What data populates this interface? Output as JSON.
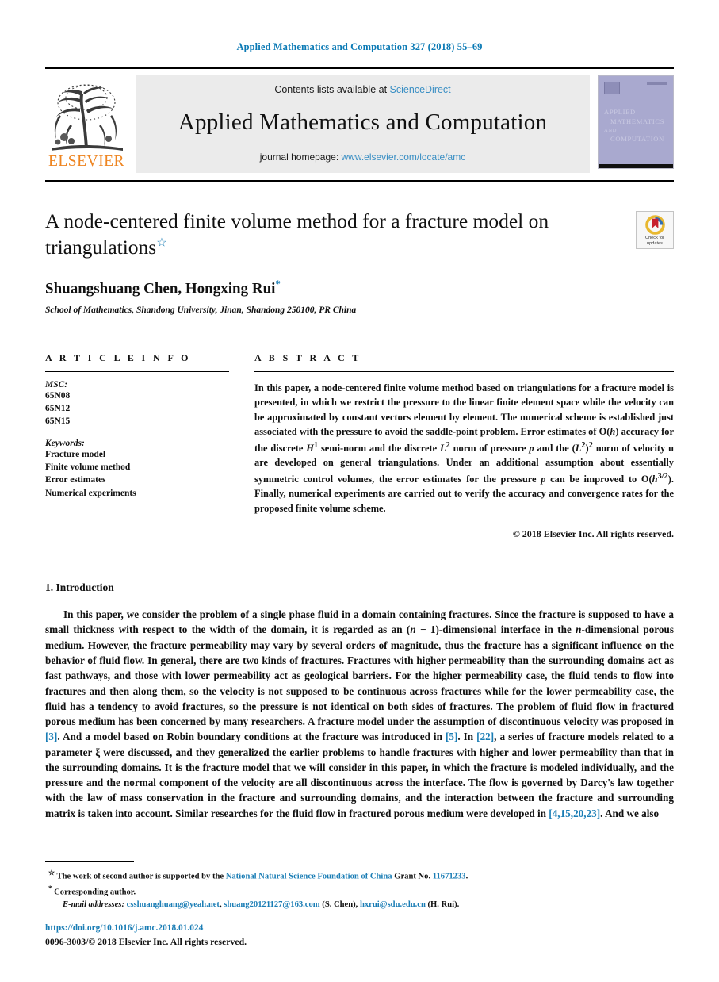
{
  "running_head": "Applied Mathematics and Computation 327 (2018) 55–69",
  "masthead": {
    "publisher_name": "ELSEVIER",
    "contents_prefix": "Contents lists available at",
    "contents_link": "ScienceDirect",
    "journal_name": "Applied Mathematics and Computation",
    "homepage_prefix": "journal homepage:",
    "homepage_url": "www.elsevier.com/locate/amc",
    "cover": {
      "line1": "APPLIED",
      "line2": "MATHEMATICS",
      "line3": "AND",
      "line4": "COMPUTATION"
    }
  },
  "article": {
    "title": "A node-centered finite volume method for a fracture model on triangulations",
    "title_footnote_symbol": "☆",
    "authors": "Shuangshuang Chen, Hongxing Rui",
    "corresponding_symbol": "*",
    "affiliation": "School of Mathematics, Shandong University, Jinan, Shandong 250100, PR China",
    "crossmark": {
      "line1": "Check for",
      "line2": "updates"
    }
  },
  "info": {
    "heading": "A R T I C L E   I N F O",
    "msc_label": "MSC:",
    "msc_codes": [
      "65N08",
      "65N12",
      "65N15"
    ],
    "keywords_label": "Keywords:",
    "keywords": [
      "Fracture model",
      "Finite volume method",
      "Error estimates",
      "Numerical experiments"
    ]
  },
  "abstract": {
    "heading": "A B S T R A C T",
    "part1": "In this paper, a node-centered finite volume method based on triangulations for a fracture model is presented, in which we restrict the pressure to the linear finite element space while the velocity can be approximated by constant vectors element by element. The numerical scheme is established just associated with the pressure to avoid the saddle-point problem. Error estimates of O(",
    "h1": "h",
    "part2": ") accuracy for the discrete ",
    "H1": "H",
    "sup1": "1",
    "part3": " semi-norm and the discrete ",
    "L1": "L",
    "sup2": "2",
    "part4": " norm of pressure ",
    "p1": "p",
    "part5": " and the (",
    "L2": "L",
    "sup3": "2",
    "part6": ")",
    "sup4": "2",
    "part7": " norm of velocity ",
    "u1": "u",
    "part8": " are developed on general triangulations. Under an additional assumption about essentially symmetric control volumes, the error estimates for the pressure ",
    "p2": "p",
    "part9": " can be improved to O(",
    "h2": "h",
    "sup5": "3/2",
    "part10": "). Finally, numerical experiments are carried out to verify the accuracy and convergence rates for the proposed finite volume scheme.",
    "copyright": "© 2018 Elsevier Inc. All rights reserved."
  },
  "body": {
    "section_number_title": "1. Introduction",
    "paragraph": {
      "s1": "In this paper, we consider the problem of a single phase fluid in a domain containing fractures. Since the fracture is supposed to have a small thickness with respect to the width of the domain, it is regarded as an (",
      "n1": "n",
      "s2": " − 1)-dimensional interface in the ",
      "n2": "n",
      "s3": "-dimensional porous medium. However, the fracture permeability may vary by several orders of magnitude, thus the fracture has a significant influence on the behavior of fluid flow. In general, there are two kinds of fractures. Fractures with higher permeability than the surrounding domains act as fast pathways, and those with lower permeability act as geological barriers. For the higher permeability case, the fluid tends to flow into fractures and then along them, so the velocity is not supposed to be continuous across fractures while for the lower permeability case, the fluid has a tendency to avoid fractures, so the pressure is not identical on both sides of fractures. The problem of fluid flow in fractured porous medium has been concerned by many researchers. A fracture model under the assumption of discontinuous velocity was proposed in ",
      "ref1": "[3]",
      "s4": ". And a model based on Robin boundary conditions at the fracture was introduced in ",
      "ref2": "[5]",
      "s5": ". In ",
      "ref3": "[22]",
      "s6": ", a series of fracture models related to a parameter ξ were discussed, and they generalized the earlier problems to handle fractures with higher and lower permeability than that in the surrounding domains. It is the fracture model that we will consider in this paper, in which the fracture is modeled individually, and the pressure and the normal component of the velocity are all discontinuous across the interface. The flow is governed by Darcy's law together with the law of mass conservation in the fracture and surrounding domains, and the interaction between the fracture and surrounding matrix is taken into account. Similar researches for the fluid flow in fractured porous medium were developed in ",
      "ref4": "[4,15,20,23]",
      "s7": ". And we also"
    }
  },
  "footnotes": {
    "star_symbol": "☆",
    "funding_pre": "The work of second author is supported by the ",
    "funding_link": "National Natural Science Foundation of China",
    "funding_post": " Grant No. ",
    "grant_number": "11671233",
    "funding_end": ".",
    "corresponding_symbol": "*",
    "corresponding_text": "Corresponding author.",
    "email_label": "E-mail addresses:",
    "email1": "csshuanghuang@yeah.net",
    "email2": "shuang20121127@163.com",
    "email_author1": "(S. Chen),",
    "email3": "hxrui@sdu.edu.cn",
    "email_author2": "(H. Rui)."
  },
  "bottom": {
    "doi": "https://doi.org/10.1016/j.amc.2018.01.024",
    "issn_line": "0096-3003/© 2018 Elsevier Inc. All rights reserved."
  },
  "colors": {
    "link_blue": "#1a7db5",
    "elsevier_orange": "#ee8521",
    "cover_purple": "#a9a9cf"
  }
}
